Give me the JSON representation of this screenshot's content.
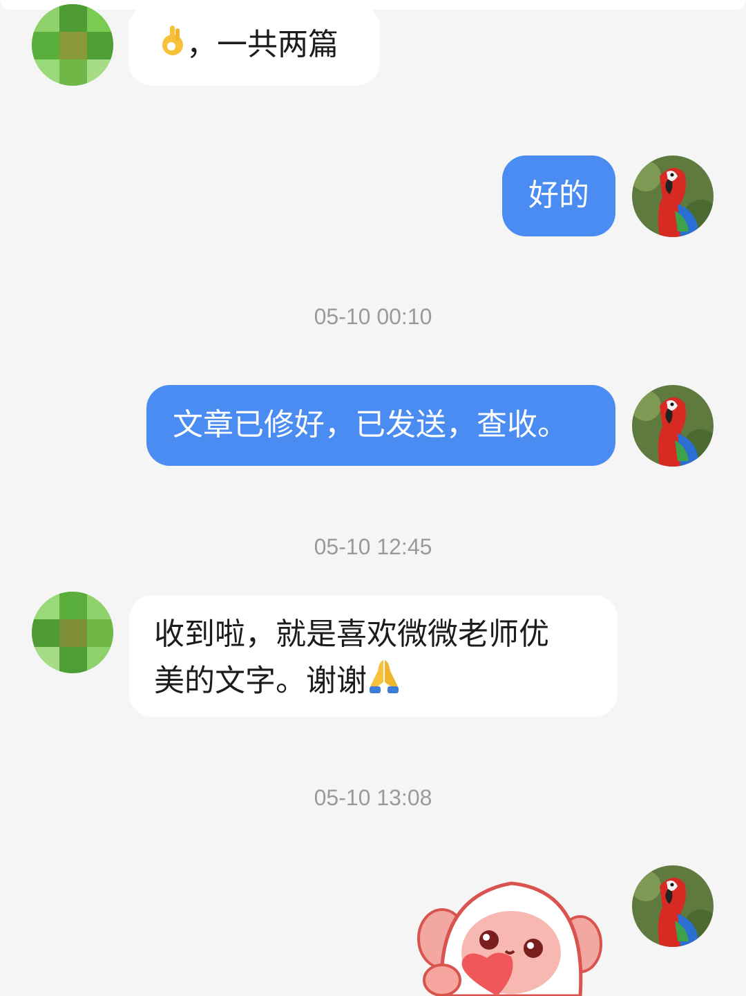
{
  "messages": [
    {
      "direction": "in",
      "emoji": "ok-hand-emoji",
      "text": "，一共两篇"
    },
    {
      "direction": "out",
      "text": "好的"
    },
    {
      "direction": "out",
      "text": "文章已修好，已发送，查收。"
    },
    {
      "direction": "in",
      "line1": "收到啦，就是喜欢微微老师优",
      "line2": "美的文字。谢谢",
      "emoji": "folded-hands-emoji"
    },
    {
      "direction": "out",
      "sticker": "lamb-holding-heart-sticker"
    }
  ],
  "timestamps": [
    "05-10 00:10",
    "05-10 12:45",
    "05-10 13:08"
  ],
  "avatars": {
    "contact": "blurred-green-avatar",
    "self": "parrot-avatar"
  },
  "colors": {
    "background": "#f5f5f5",
    "incoming_bubble": "#ffffff",
    "outgoing_bubble": "#4b8cf2",
    "timestamp_text": "#9a9a9a"
  }
}
